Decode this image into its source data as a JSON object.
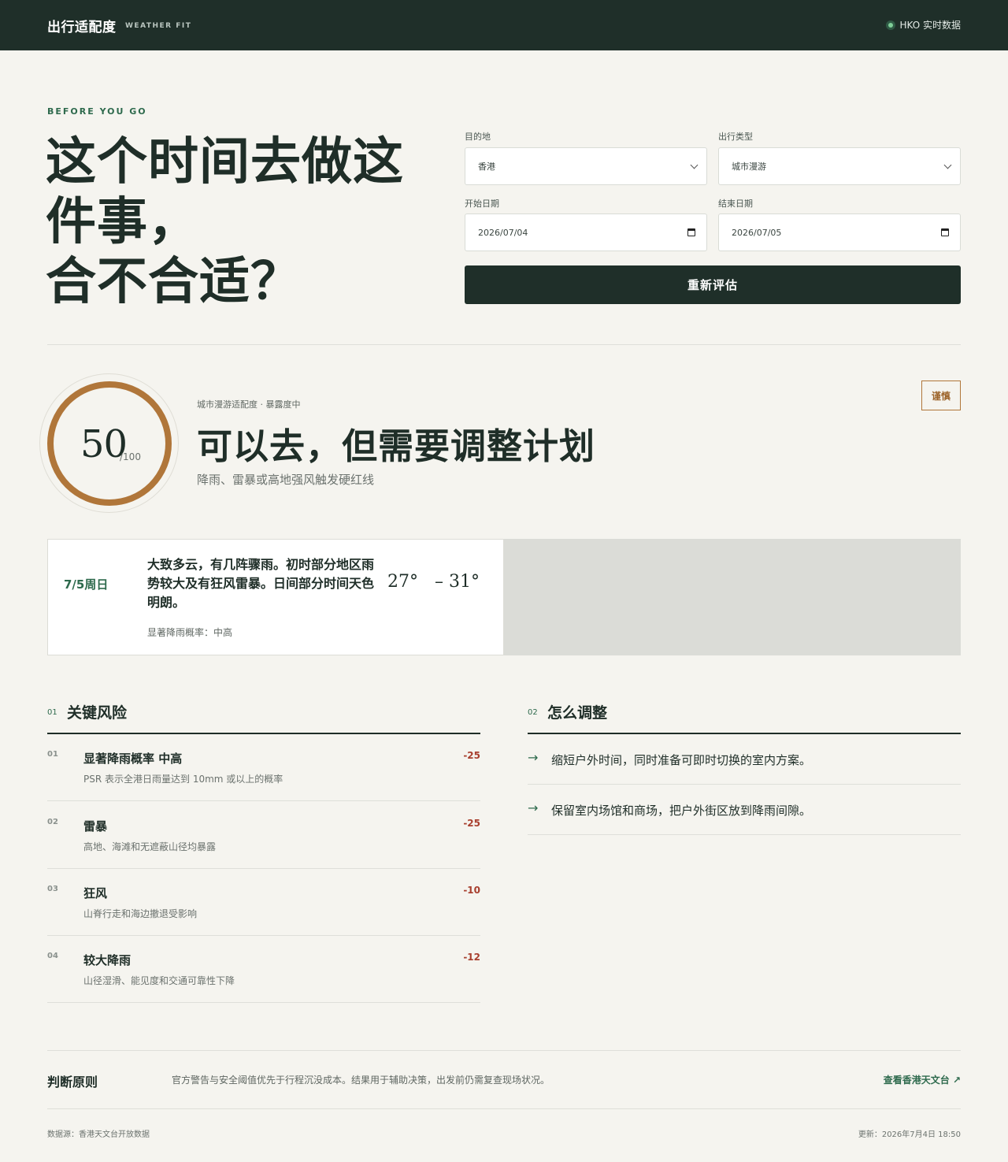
{
  "header": {
    "brand": "出行适配度",
    "brand_sub": "WEATHER FIT",
    "live_label": "HKO 实时数据",
    "live_color": "#7fcf98"
  },
  "hero": {
    "eyebrow": "BEFORE YOU GO",
    "title": "这个时间去做这\n件事，\n合不合适？"
  },
  "form": {
    "destination_label": "目的地",
    "destination_value": "香港",
    "type_label": "出行类型",
    "type_value": "城市漫游",
    "start_label": "开始日期",
    "start_value": "2026/07/04",
    "end_label": "结束日期",
    "end_value": "2026/07/05",
    "submit_label": "重新评估"
  },
  "result": {
    "score": "50",
    "score_max": "/100",
    "ring_color": "#b0763a",
    "meta": "城市漫游适配度 · 暴露度中",
    "verdict": "可以去，但需要调整计划",
    "subtitle": "降雨、雷暴或高地强风触发硬红线",
    "badge": "谨慎"
  },
  "forecast": {
    "date": "7/5周日",
    "description": "大致多云，有几阵骤雨。初时部分地区雨势较大及有狂风雷暴。日间部分时间天色明朗。",
    "temp_low": "27°",
    "temp_high": "31°",
    "temp_sep": "–",
    "psr": "显著降雨概率：中高"
  },
  "risks": {
    "num": "01",
    "title": "关键风险",
    "items": [
      {
        "num": "01",
        "title": "显著降雨概率 中高",
        "desc": "PSR 表示全港日雨量达到 10mm 或以上的概率",
        "score": "-25"
      },
      {
        "num": "02",
        "title": "雷暴",
        "desc": "高地、海滩和无遮蔽山径均暴露",
        "score": "-25"
      },
      {
        "num": "03",
        "title": "狂风",
        "desc": "山脊行走和海边撤退受影响",
        "score": "-10"
      },
      {
        "num": "04",
        "title": "较大降雨",
        "desc": "山径湿滑、能见度和交通可靠性下降",
        "score": "-12"
      }
    ]
  },
  "adjust": {
    "num": "02",
    "title": "怎么调整",
    "items": [
      {
        "arrow": "→",
        "text": "缩短户外时间，同时准备可即时切换的室内方案。"
      },
      {
        "arrow": "→",
        "text": "保留室内场馆和商场，把户外街区放到降雨间隙。"
      }
    ]
  },
  "footer": {
    "principle_title": "判断原则",
    "principle_text": "官方警告与安全阈值优先于行程沉没成本。结果用于辅助决策，出发前仍需复查现场状况。",
    "link": "查看香港天文台 ↗",
    "source": "数据源：香港天文台开放数据",
    "updated": "更新：2026年7月4日 18:50"
  }
}
